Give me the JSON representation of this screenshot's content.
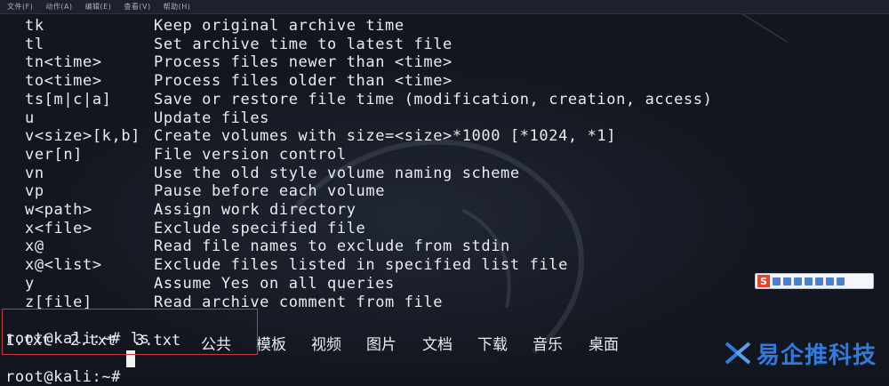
{
  "menubar": {
    "items": [
      "文件(F)",
      "动作(A)",
      "编辑(E)",
      "查看(V)",
      "帮助(H)"
    ]
  },
  "options": [
    {
      "opt": "tk",
      "desc": "Keep original archive time"
    },
    {
      "opt": "tl",
      "desc": "Set archive time to latest file"
    },
    {
      "opt": "tn<time>",
      "desc": "Process files newer than <time>"
    },
    {
      "opt": "to<time>",
      "desc": "Process files older than <time>"
    },
    {
      "opt": "ts[m|c|a]",
      "desc": "Save or restore file time (modification, creation, access)"
    },
    {
      "opt": "u",
      "desc": "Update files"
    },
    {
      "opt": "v<size>[k,b]",
      "desc": "Create volumes with size=<size>*1000 [*1024, *1]"
    },
    {
      "opt": "ver[n]",
      "desc": "File version control"
    },
    {
      "opt": "vn",
      "desc": "Use the old style volume naming scheme"
    },
    {
      "opt": "vp",
      "desc": "Pause before each volume"
    },
    {
      "opt": "w<path>",
      "desc": "Assign work directory"
    },
    {
      "opt": "x<file>",
      "desc": "Exclude specified file"
    },
    {
      "opt": "x@",
      "desc": "Read file names to exclude from stdin"
    },
    {
      "opt": "x@<list>",
      "desc": "Exclude files listed in specified list file"
    },
    {
      "opt": "y",
      "desc": "Assume Yes on all queries"
    },
    {
      "opt": "z[file]",
      "desc": "Read archive comment from file"
    }
  ],
  "shell": {
    "prompt_ls": "root@kali:~# ls",
    "ls_output": [
      "1.txt",
      "2.txt",
      "3.txt",
      "公共",
      "模板",
      "视频",
      "图片",
      "文档",
      "下载",
      "音乐",
      "桌面"
    ],
    "prompt_current": "root@kali:~# "
  },
  "ime": {
    "logo": "S"
  },
  "watermark": {
    "text": "易企推科技"
  },
  "colors": {
    "accent_red": "#c43a3a",
    "watermark_blue": "#2f7be0",
    "terminal_bg": "#12161f"
  }
}
